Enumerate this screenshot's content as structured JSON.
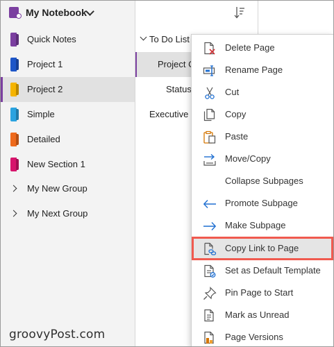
{
  "notebook": {
    "title": "My Notebook"
  },
  "sections": [
    {
      "label": "Quick Notes",
      "color": "#7b3fa0"
    },
    {
      "label": "Project 1",
      "color": "#1e56c8"
    },
    {
      "label": "Project 2",
      "color": "#f5b400",
      "selected": true
    },
    {
      "label": "Simple",
      "color": "#2aa3e0"
    },
    {
      "label": "Detailed",
      "color": "#ee6a1c"
    },
    {
      "label": "New Section 1",
      "color": "#d7146c"
    }
  ],
  "groups": [
    {
      "label": "My New Group"
    },
    {
      "label": "My Next Group"
    }
  ],
  "pages": {
    "group_label": "To Do List",
    "items": [
      {
        "label": "Project C"
      },
      {
        "label": "Status"
      },
      {
        "label": "Executive S"
      }
    ]
  },
  "context_menu": {
    "items": [
      {
        "label": "Delete Page",
        "icon": "delete-page-icon"
      },
      {
        "label": "Rename Page",
        "icon": "rename-page-icon"
      },
      {
        "label": "Cut",
        "icon": "scissors-icon"
      },
      {
        "label": "Copy",
        "icon": "copy-icon"
      },
      {
        "label": "Paste",
        "icon": "paste-icon"
      },
      {
        "label": "Move/Copy",
        "icon": "move-copy-icon"
      },
      {
        "label": "Collapse Subpages",
        "icon": ""
      },
      {
        "label": "Promote Subpage",
        "icon": "arrow-left-icon"
      },
      {
        "label": "Make Subpage",
        "icon": "arrow-right-icon"
      },
      {
        "label": "Copy Link to Page",
        "icon": "copy-link-icon",
        "highlighted": true
      },
      {
        "label": "Set as Default Template",
        "icon": "template-icon"
      },
      {
        "label": "Pin Page to Start",
        "icon": "pin-icon"
      },
      {
        "label": "Mark as Unread",
        "icon": "mark-unread-icon"
      },
      {
        "label": "Page Versions",
        "icon": "page-versions-icon"
      }
    ]
  },
  "watermark": "groovyPost.com",
  "colors": {
    "accent": "#7b3fa0",
    "highlight_border": "#f05a4f"
  }
}
